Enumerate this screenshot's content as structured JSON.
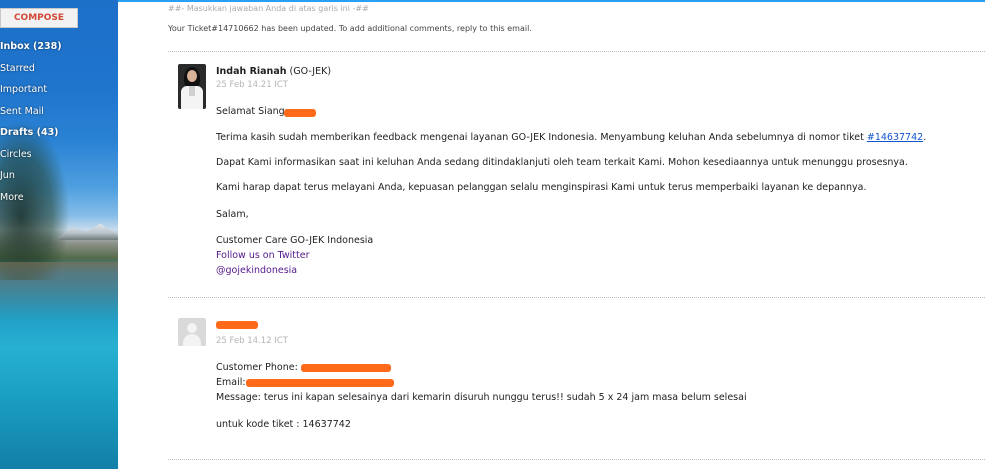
{
  "sidebar": {
    "compose_label": "COMPOSE",
    "items": [
      {
        "label": "Inbox (238)"
      },
      {
        "label": "Starred"
      },
      {
        "label": "Important"
      },
      {
        "label": "Sent Mail"
      },
      {
        "label": "Drafts (43)"
      },
      {
        "label": "Circles"
      },
      {
        "label": "Jun"
      },
      {
        "label": "More"
      }
    ]
  },
  "colors": {
    "accent": "#2a9df4",
    "compose_text": "#d14836",
    "link": "#1155cc",
    "redaction": "#ff6a1a"
  },
  "thread": {
    "reply_marker": "##- Masukkan jawaban Anda di atas garis ini -##",
    "update_notice": "Your Ticket#14710662 has been updated. To add additional comments, reply to this email.",
    "messages": [
      {
        "sender_name": "Indah Rianah",
        "sender_org": "(GO-JEK)",
        "date": "25 Feb 14.21 ICT",
        "greeting": "Selamat Siang",
        "para1_text": "Terima kasih sudah memberikan feedback mengenai layanan GO-JEK Indonesia. Menyambung keluhan Anda sebelumnya di nomor tiket ",
        "para1_link": "#14637742",
        "para1_end": ".",
        "para2": "Dapat Kami informasikan saat ini keluhan Anda sedang ditindaklanjuti oleh team terkait Kami. Mohon kesediaannya untuk menunggu prosesnya.",
        "para3": "Kami harap dapat terus melayani Anda, kepuasan pelanggan selalu menginspirasi Kami untuk terus memperbaiki layanan ke depannya.",
        "closing": "Salam,",
        "signature": "Customer Care GO-JEK Indonesia",
        "follow": "Follow us on Twitter",
        "handle": "@gojekindonesia"
      },
      {
        "date": "25 Feb 14.12 ICT",
        "phone_label": "Customer Phone: ",
        "email_label": "Email: ",
        "message": "Message: terus ini kapan selesainya dari kemarin disuruh nunggu terus!! sudah 5 x 24 jam masa belum selesai",
        "ticket_code": "untuk kode tiket : 14637742"
      }
    ]
  }
}
